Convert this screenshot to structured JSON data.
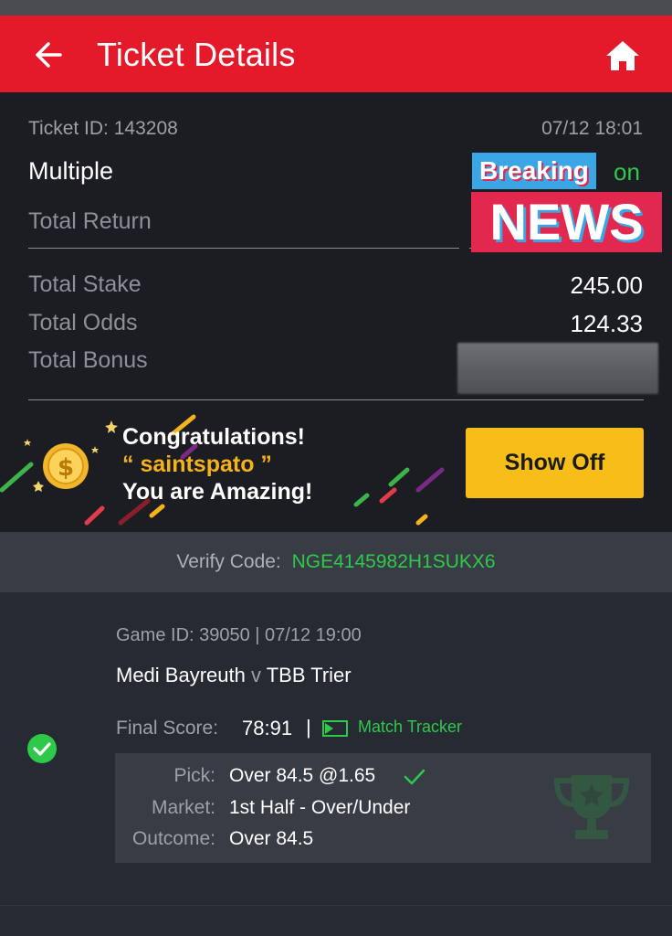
{
  "header": {
    "title": "Ticket Details",
    "back_icon": "arrow-left-icon",
    "home_icon": "home-icon",
    "background": "#e4192a"
  },
  "ticket": {
    "id_label": "Ticket ID: 143208",
    "datetime": "07/12 18:01",
    "bet_type": "Multiple",
    "status": "Won",
    "total_return_label": "Total Return",
    "total_stake_label": "Total Stake",
    "total_stake_value": "245.00",
    "total_odds_label": "Total Odds",
    "total_odds_value": "124.33",
    "total_bonus_label": "Total Bonus"
  },
  "overlay": {
    "breaking": "Breaking",
    "news": "NEWS"
  },
  "promo": {
    "line1": "Congratulations!",
    "username": "“ saintspato ”",
    "line3": "You are Amazing!",
    "button": "Show Off",
    "coin_icon": "coin-icon"
  },
  "verify": {
    "label": "Verify Code:",
    "code": "NGE4145982H1SUKX6"
  },
  "game": {
    "game_id": "Game ID: 39050 | 07/12 19:00",
    "home_team": "Medi Bayreuth",
    "vs": "v",
    "away_team": "TBB Trier",
    "final_score_label": "Final Score:",
    "final_score": "78:91",
    "separator": "|",
    "tracker_label": "Match Tracker",
    "pick_label": "Pick:",
    "pick_value": "Over 84.5 @1.65",
    "market_label": "Market:",
    "market_value": "1st Half - Over/Under",
    "outcome_label": "Outcome:",
    "outcome_value": "Over 84.5",
    "result_icon": "check-circle-icon",
    "accent": "#2fc94a"
  }
}
